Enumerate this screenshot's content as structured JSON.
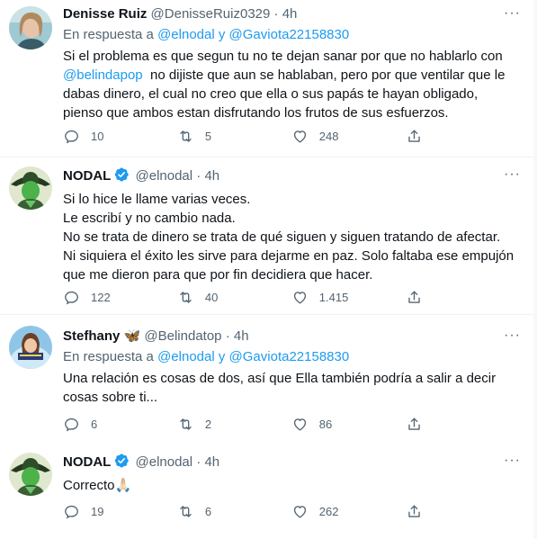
{
  "tweets": [
    {
      "name": "Denisse Ruiz",
      "handle": "@DenisseRuiz0329",
      "sep": "·",
      "time": "4h",
      "reply_prefix": "En respuesta a ",
      "reply_mention1": "@elnodal",
      "reply_and": " y ",
      "reply_mention2": "@Gaviota22158830",
      "body_part1": "Si el problema es que segun tu no te dejan sanar por que no hablarlo con\n",
      "body_mention": "@belindapop",
      "body_part2": "  no dijiste que aun se hablaban, pero por que ventilar que le dabas dinero, el cual no creo que ella o sus papás te hayan obligado, pienso que ambos estan disfrutando los frutos de sus esfuerzos.",
      "replies": "10",
      "retweets": "5",
      "likes": "248",
      "more": "···"
    },
    {
      "name": "NODAL",
      "handle": "@elnodal",
      "sep": "·",
      "time": "4h",
      "body": "Si lo hice le llame varias veces.\nLe escribí y no cambio nada.\nNo se trata de dinero se trata de qué siguen y siguen tratando de afectar.\nNi siquiera el éxito les sirve para dejarme en paz. Solo faltaba ese empujón que me dieron para que por fin decidiera que hacer.",
      "replies": "122",
      "retweets": "40",
      "likes": "1.415",
      "more": "···"
    },
    {
      "name": "Stefhany",
      "name_emoji": "🦋",
      "handle": "@Belindatop",
      "sep": "·",
      "time": "4h",
      "reply_prefix": "En respuesta a ",
      "reply_mention1": "@elnodal",
      "reply_and": " y ",
      "reply_mention2": "@Gaviota22158830",
      "body": "Una relación es cosas de dos, así que Ella también podría a salir a decir cosas sobre ti...",
      "replies": "6",
      "retweets": "2",
      "likes": "86",
      "more": "···"
    },
    {
      "name": "NODAL",
      "handle": "@elnodal",
      "sep": "·",
      "time": "4h",
      "body": "Correcto",
      "body_emoji": "🙏🏻",
      "replies": "19",
      "retweets": "6",
      "likes": "262",
      "more": "···"
    }
  ],
  "colors": {
    "accent": "#1d9bf0",
    "text": "#0f1419",
    "muted": "#536471",
    "divider": "#eff3f4"
  }
}
